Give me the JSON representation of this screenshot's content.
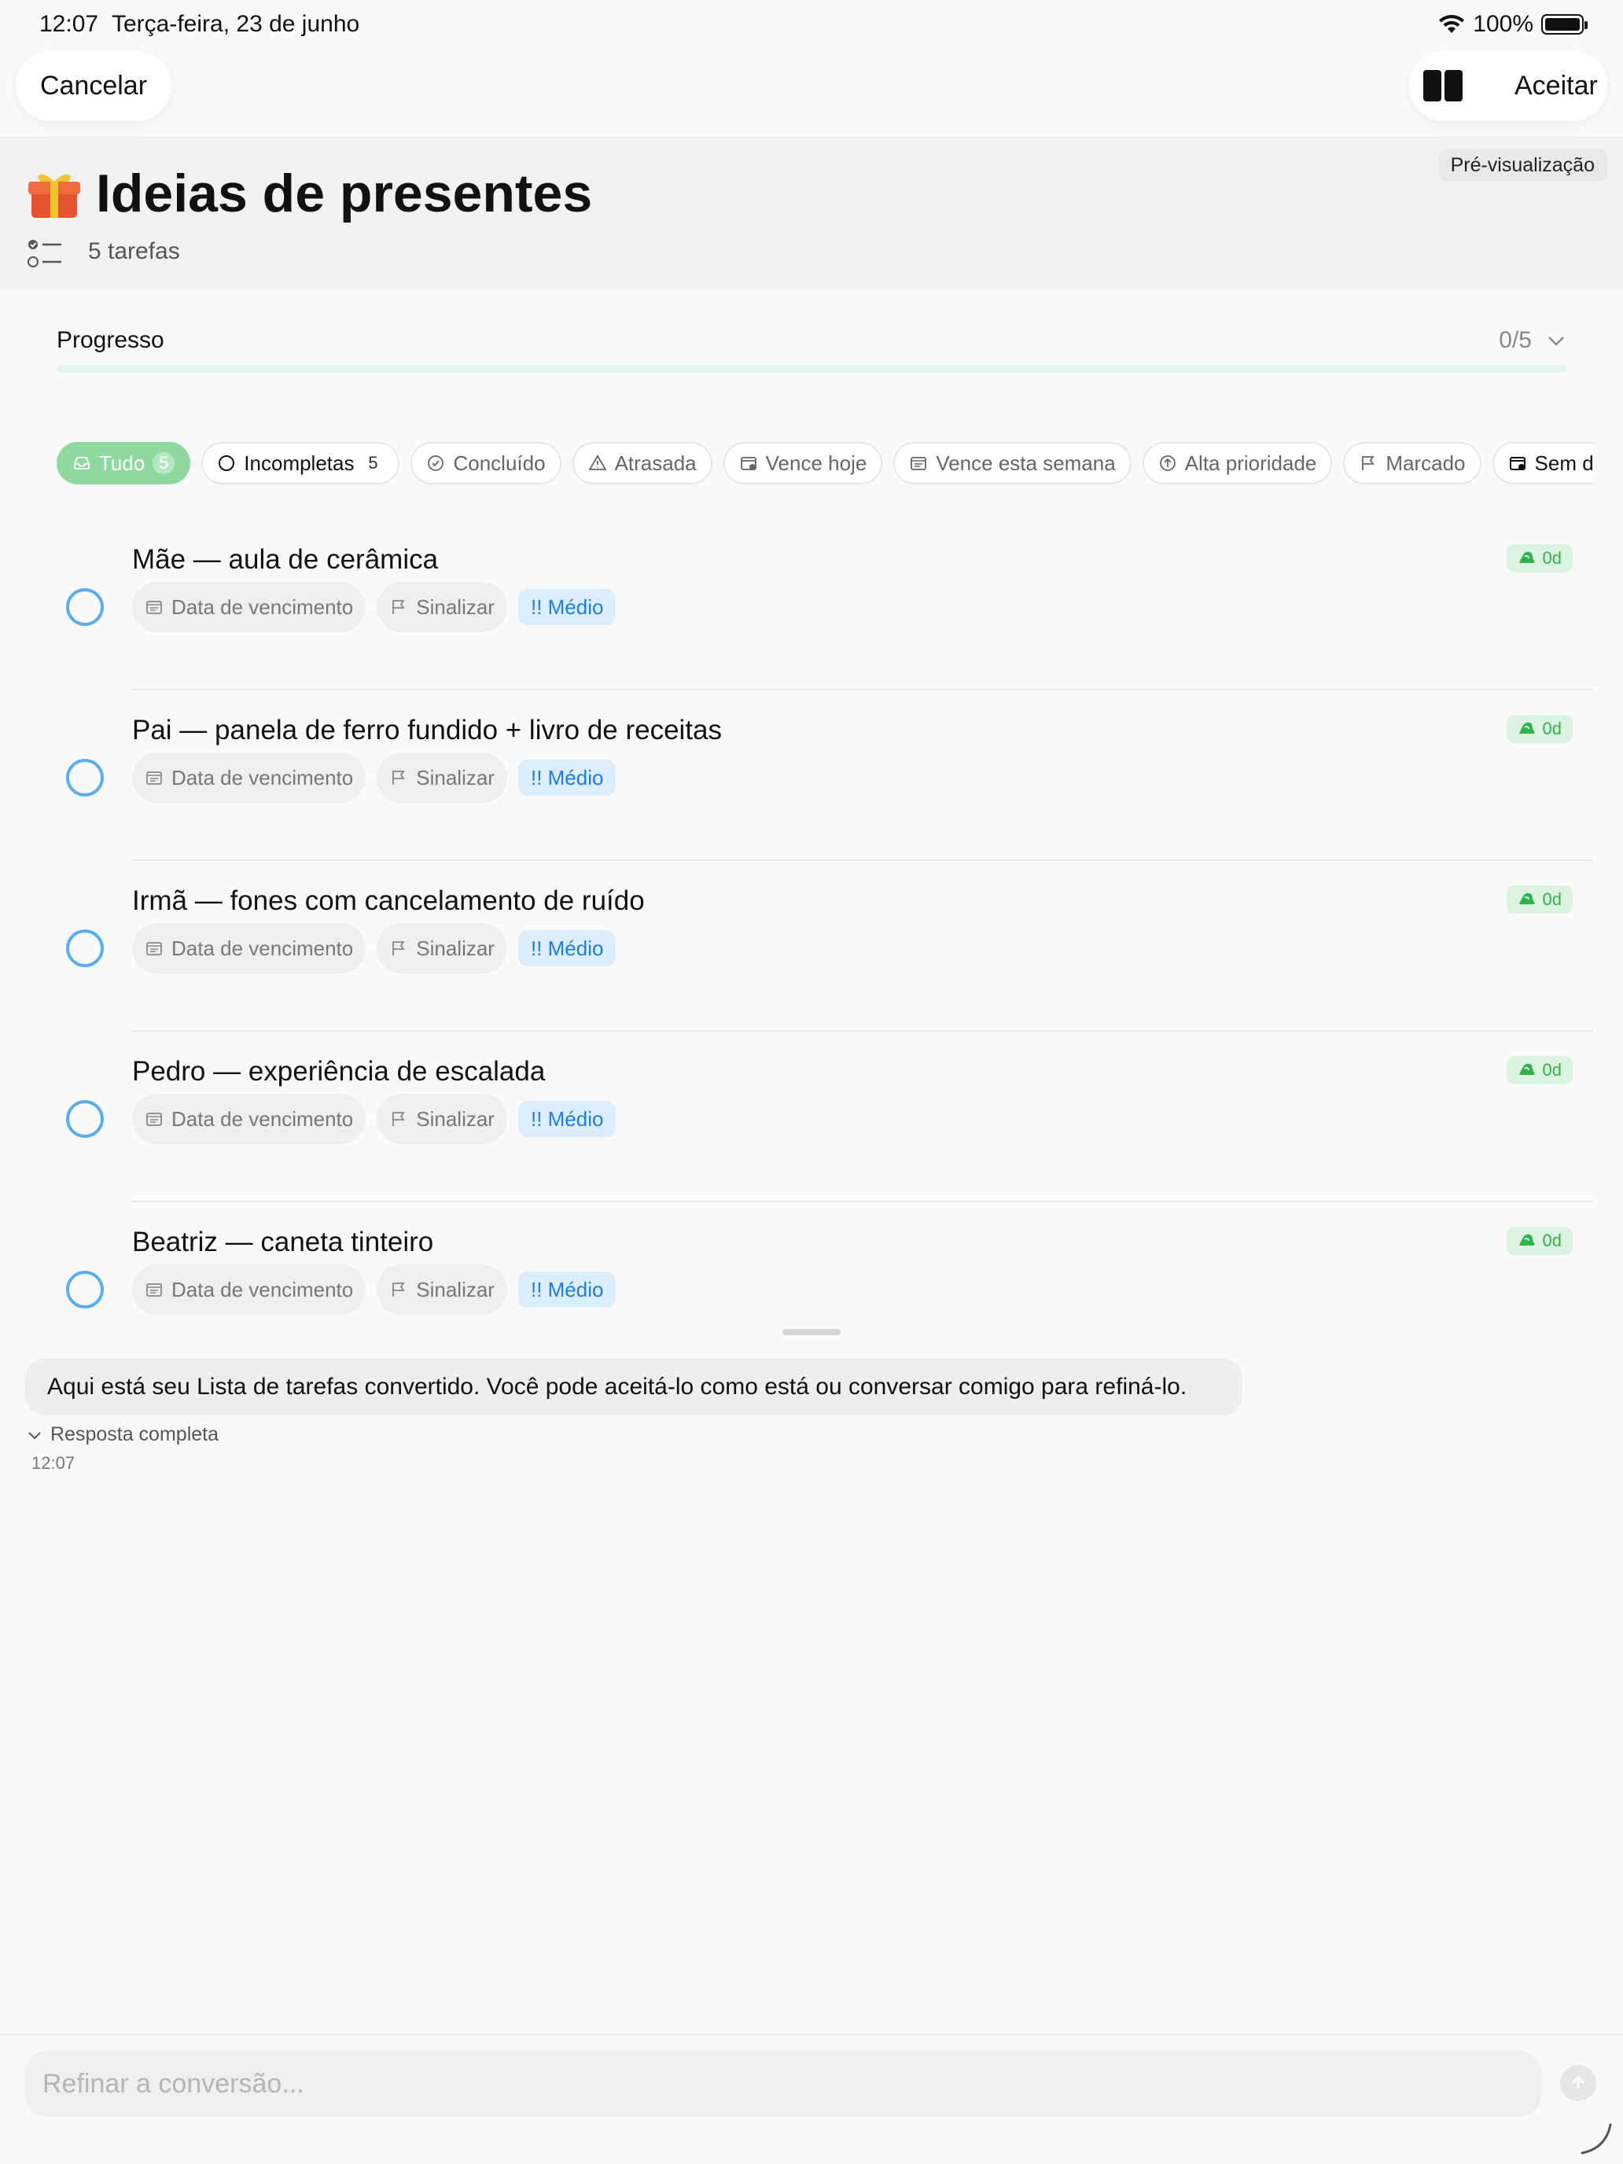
{
  "status_bar": {
    "time": "12:07",
    "date": "Terça-feira, 23 de junho",
    "battery": "100%"
  },
  "nav": {
    "cancel_label": "Cancelar",
    "accept_label": "Aceitar"
  },
  "header": {
    "preview_badge": "Pré-visualização",
    "title": "Ideias de presentes",
    "tasks_count": "5 tarefas"
  },
  "progress": {
    "label": "Progresso",
    "value": "0/5",
    "fraction": 0
  },
  "filters": [
    {
      "label": "Tudo",
      "count": "5",
      "icon": "inbox-icon",
      "active": true
    },
    {
      "label": "Incompletas",
      "count": "5",
      "icon": "circle-icon",
      "bold": true
    },
    {
      "label": "Concluído",
      "icon": "check-circle-icon"
    },
    {
      "label": "Atrasada",
      "icon": "warning-icon"
    },
    {
      "label": "Vence hoje",
      "icon": "calendar-dot-icon"
    },
    {
      "label": "Vence esta semana",
      "icon": "calendar-icon"
    },
    {
      "label": "Alta prioridade",
      "icon": "arrow-up-circle-icon"
    },
    {
      "label": "Marcado",
      "icon": "flag-icon"
    },
    {
      "label": "Sem data",
      "icon": "calendar-x-icon",
      "bold": true
    }
  ],
  "tags": {
    "due_date": "Data de vencimento",
    "flag": "Sinalizar",
    "priority": "!! Médio",
    "age": "0d"
  },
  "tasks": [
    {
      "title": "Mãe — aula de cerâmica"
    },
    {
      "title": "Pai — panela de ferro fundido + livro de receitas"
    },
    {
      "title": "Irmã — fones com cancelamento de ruído"
    },
    {
      "title": "Pedro — experiência de escalada"
    },
    {
      "title": "Beatriz — caneta tinteiro"
    }
  ],
  "chat": {
    "message": "Aqui está seu Lista de tarefas convertido. Você pode aceitá-lo como está ou conversar comigo para refiná-lo.",
    "full_reply_label": "Resposta completa",
    "time": "12:07"
  },
  "input": {
    "placeholder": "Refinar a conversão..."
  },
  "colors": {
    "accent_green": "#5cc27a",
    "chip_active": "#8fd9a0",
    "circle_blue": "#5aaef0",
    "priority_blue": "#1d7ee2"
  }
}
